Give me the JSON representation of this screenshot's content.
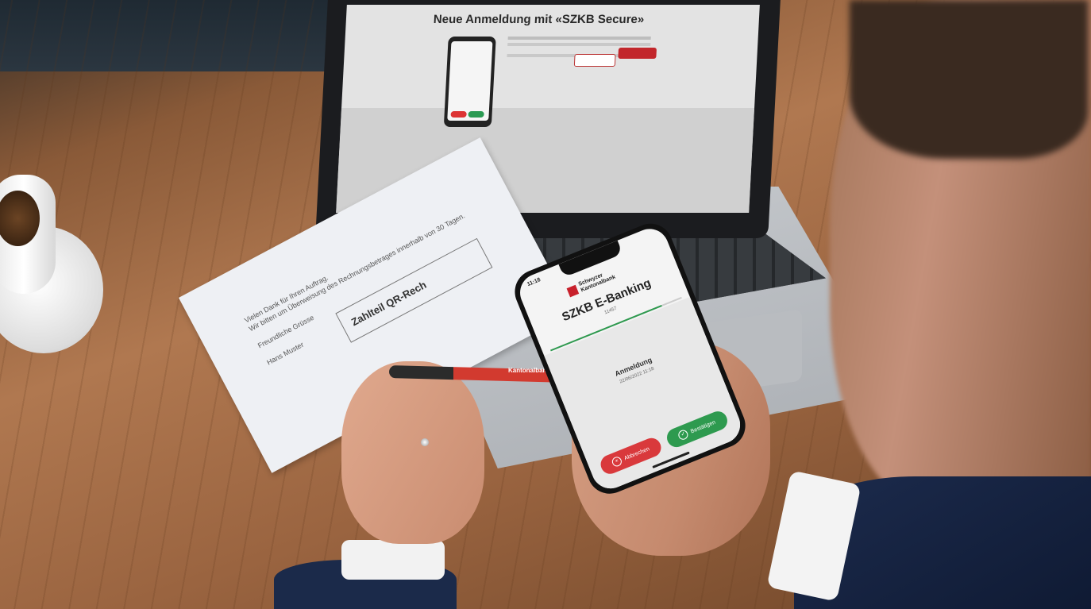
{
  "laptop": {
    "screen_title": "Neue Anmeldung mit «SZKB Secure»"
  },
  "paper": {
    "line1": "Vielen Dank für Ihren Auftrag.",
    "line2": "Wir bitten um Überweisung des Rechnungsbetrages innerhalb von 30 Tagen.",
    "greeting": "Freundliche Grüsse",
    "name": "Hans Muster",
    "invoice_label": "Zahlteil QR-Rech"
  },
  "pen": {
    "brand": "Kantonalbank"
  },
  "phone": {
    "time": "11:18",
    "logo_line1": "Schwyzer",
    "logo_line2": "Kantonalbank",
    "app_title": "SZKB E-Banking",
    "app_subtitle": "11457",
    "event_label": "Anmeldung",
    "event_date": "22/06/2022 11:18",
    "cancel_label": "Abbrechen",
    "confirm_label": "Bestätigen",
    "progress": 0.85,
    "colors": {
      "brand_red": "#c8202b",
      "cancel": "#d9393c",
      "confirm": "#2e9a4f"
    }
  }
}
